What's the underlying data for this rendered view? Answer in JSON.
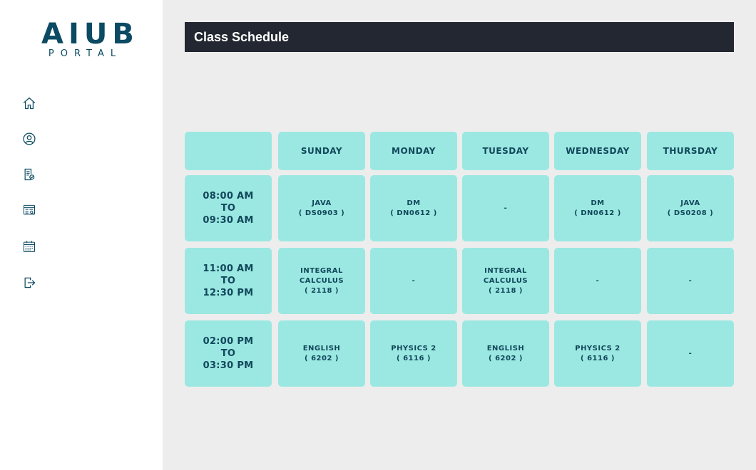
{
  "logo": {
    "main": "AIUB",
    "sub": "PORTAL"
  },
  "nav": [
    {
      "icon": "home-icon"
    },
    {
      "icon": "profile-icon"
    },
    {
      "icon": "registration-icon"
    },
    {
      "icon": "grade-report-icon"
    },
    {
      "icon": "calendar-icon"
    },
    {
      "icon": "logout-icon"
    }
  ],
  "header": {
    "title": "Class Schedule"
  },
  "schedule": {
    "days": [
      "SUNDAY",
      "MONDAY",
      "TUESDAY",
      "WEDNESDAY",
      "THURSDAY"
    ],
    "rows": [
      {
        "time": "08:00 AM\nTO\n09:30 AM",
        "classes": [
          "JAVA\n( DS0903 )",
          "DM\n( DN0612 )",
          "-",
          "DM\n( DN0612 )",
          "JAVA\n( DS0208 )"
        ]
      },
      {
        "time": "11:00 AM\nTO\n12:30 PM",
        "classes": [
          "INTEGRAL\nCALCULUS\n( 2118 )",
          "-",
          "INTEGRAL\nCALCULUS\n( 2118 )",
          "-",
          "-"
        ]
      },
      {
        "time": "02:00 PM\nTO\n03:30 PM",
        "classes": [
          "ENGLISH\n( 6202 )",
          "PHYSICS 2\n( 6116 )",
          "ENGLISH\n( 6202 )",
          "PHYSICS 2\n( 6116 )",
          "-"
        ]
      }
    ]
  },
  "colors": {
    "accent": "#0b4a62",
    "cell": "#9be8e2",
    "header_bg": "#222731"
  }
}
